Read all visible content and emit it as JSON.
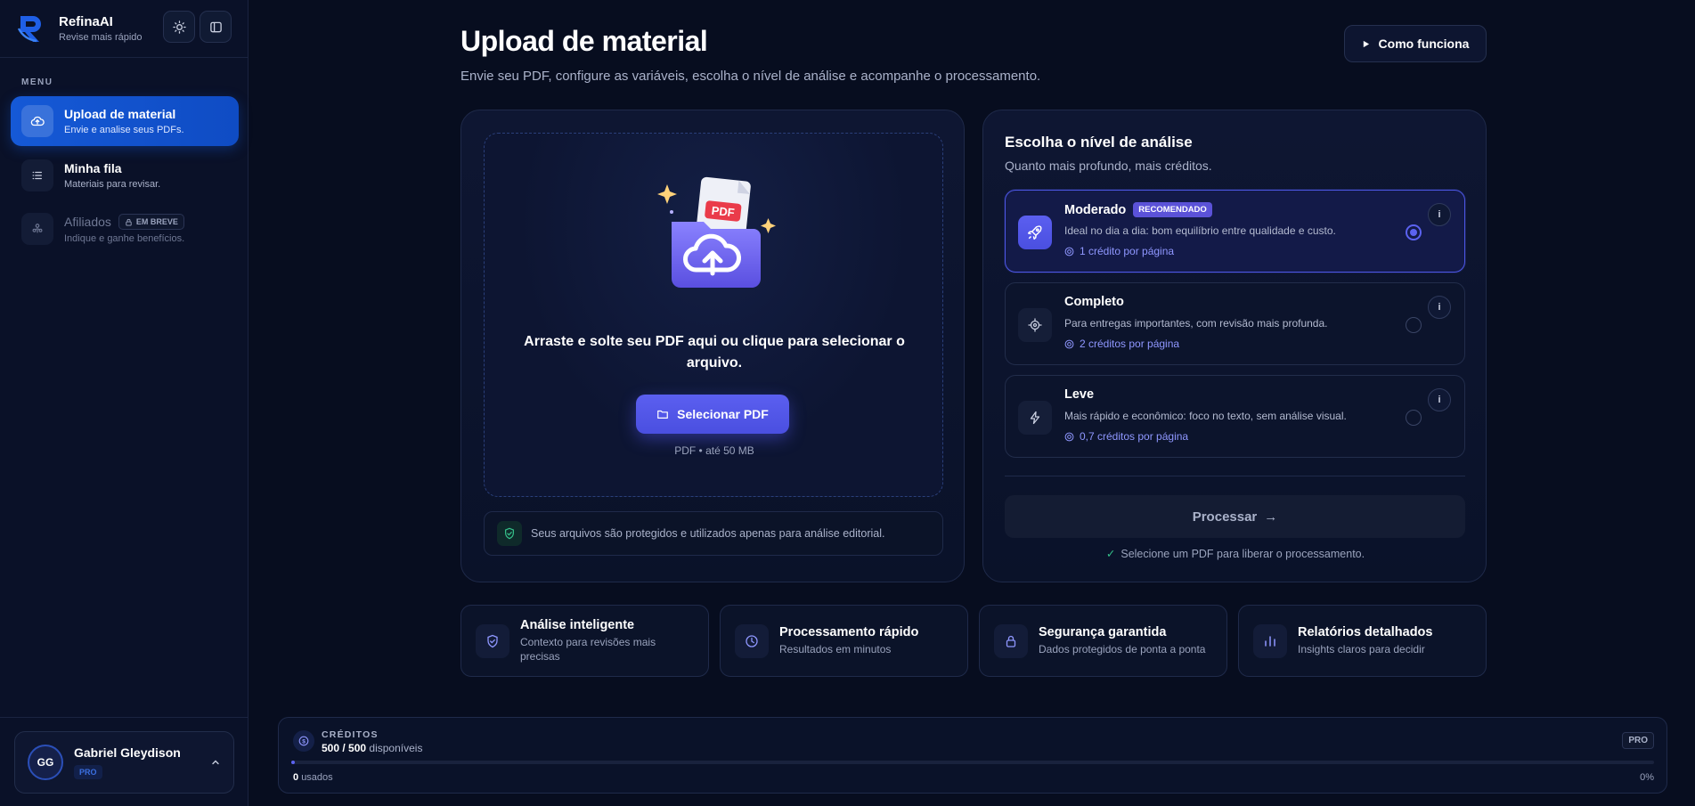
{
  "brand": {
    "name": "RefinaAI",
    "tagline": "Revise mais rápido"
  },
  "sidebar": {
    "menu_label": "MENU",
    "items": [
      {
        "label": "Upload de material",
        "sub": "Envie e analise seus PDFs.",
        "icon": "cloud-upload-icon",
        "active": true
      },
      {
        "label": "Minha fila",
        "sub": "Materiais para revisar.",
        "icon": "list-icon"
      },
      {
        "label": "Afiliados",
        "sub": "Indique e ganhe benefícios.",
        "icon": "affiliate-icon",
        "badge": "EM BREVE",
        "disabled": true
      }
    ],
    "user": {
      "initials": "GG",
      "name": "Gabriel Gleydison",
      "plan": "PRO"
    }
  },
  "header": {
    "title": "Upload de material",
    "subtitle": "Envie seu PDF, configure as variáveis, escolha o nível de análise e acompanhe o processamento.",
    "how_button": "Como funciona"
  },
  "upload": {
    "badge_text": "PDF",
    "drop_text": "Arraste e solte seu PDF aqui ou clique para selecionar o arquivo.",
    "select_button": "Selecionar PDF",
    "file_hint": "PDF • até 50 MB",
    "privacy_text": "Seus arquivos são protegidos e utilizados apenas para análise editorial."
  },
  "analysis": {
    "title": "Escolha o nível de análise",
    "subtitle": "Quanto mais profundo, mais créditos.",
    "options": [
      {
        "title": "Moderado",
        "badge": "RECOMENDADO",
        "desc": "Ideal no dia a dia: bom equilíbrio entre qualidade e custo.",
        "credits": "1 crédito por página",
        "icon": "rocket-icon",
        "selected": true
      },
      {
        "title": "Completo",
        "desc": "Para entregas importantes, com revisão mais profunda.",
        "credits": "2 créditos por página",
        "icon": "target-icon",
        "selected": false
      },
      {
        "title": "Leve",
        "desc": "Mais rápido e econômico: foco no texto, sem análise visual.",
        "credits": "0,7 créditos por página",
        "icon": "lightning-icon",
        "selected": false
      }
    ],
    "info_label": "i",
    "process_button": "Processar",
    "process_arrow": "→",
    "note": "Selecione um PDF para liberar o processamento."
  },
  "features": [
    {
      "title": "Análise inteligente",
      "sub": "Contexto para revisões mais precisas",
      "icon": "shield-check-icon"
    },
    {
      "title": "Processamento rápido",
      "sub": "Resultados em minutos",
      "icon": "clock-icon"
    },
    {
      "title": "Segurança garantida",
      "sub": "Dados protegidos de ponta a ponta",
      "icon": "lock-icon"
    },
    {
      "title": "Relatórios detalhados",
      "sub": "Insights claros para decidir",
      "icon": "bar-chart-icon"
    }
  ],
  "credits": {
    "label": "CRÉDITOS",
    "available": "500",
    "total": "500",
    "available_suffix": "disponíveis",
    "plan": "PRO",
    "used": "0",
    "used_suffix": "usados",
    "percent": "0%",
    "fill_fraction": 0.002
  },
  "colors": {
    "accent": "#5b62f0",
    "primary_blue": "#1559d6",
    "background": "#070d1f",
    "success": "#35c08a"
  }
}
